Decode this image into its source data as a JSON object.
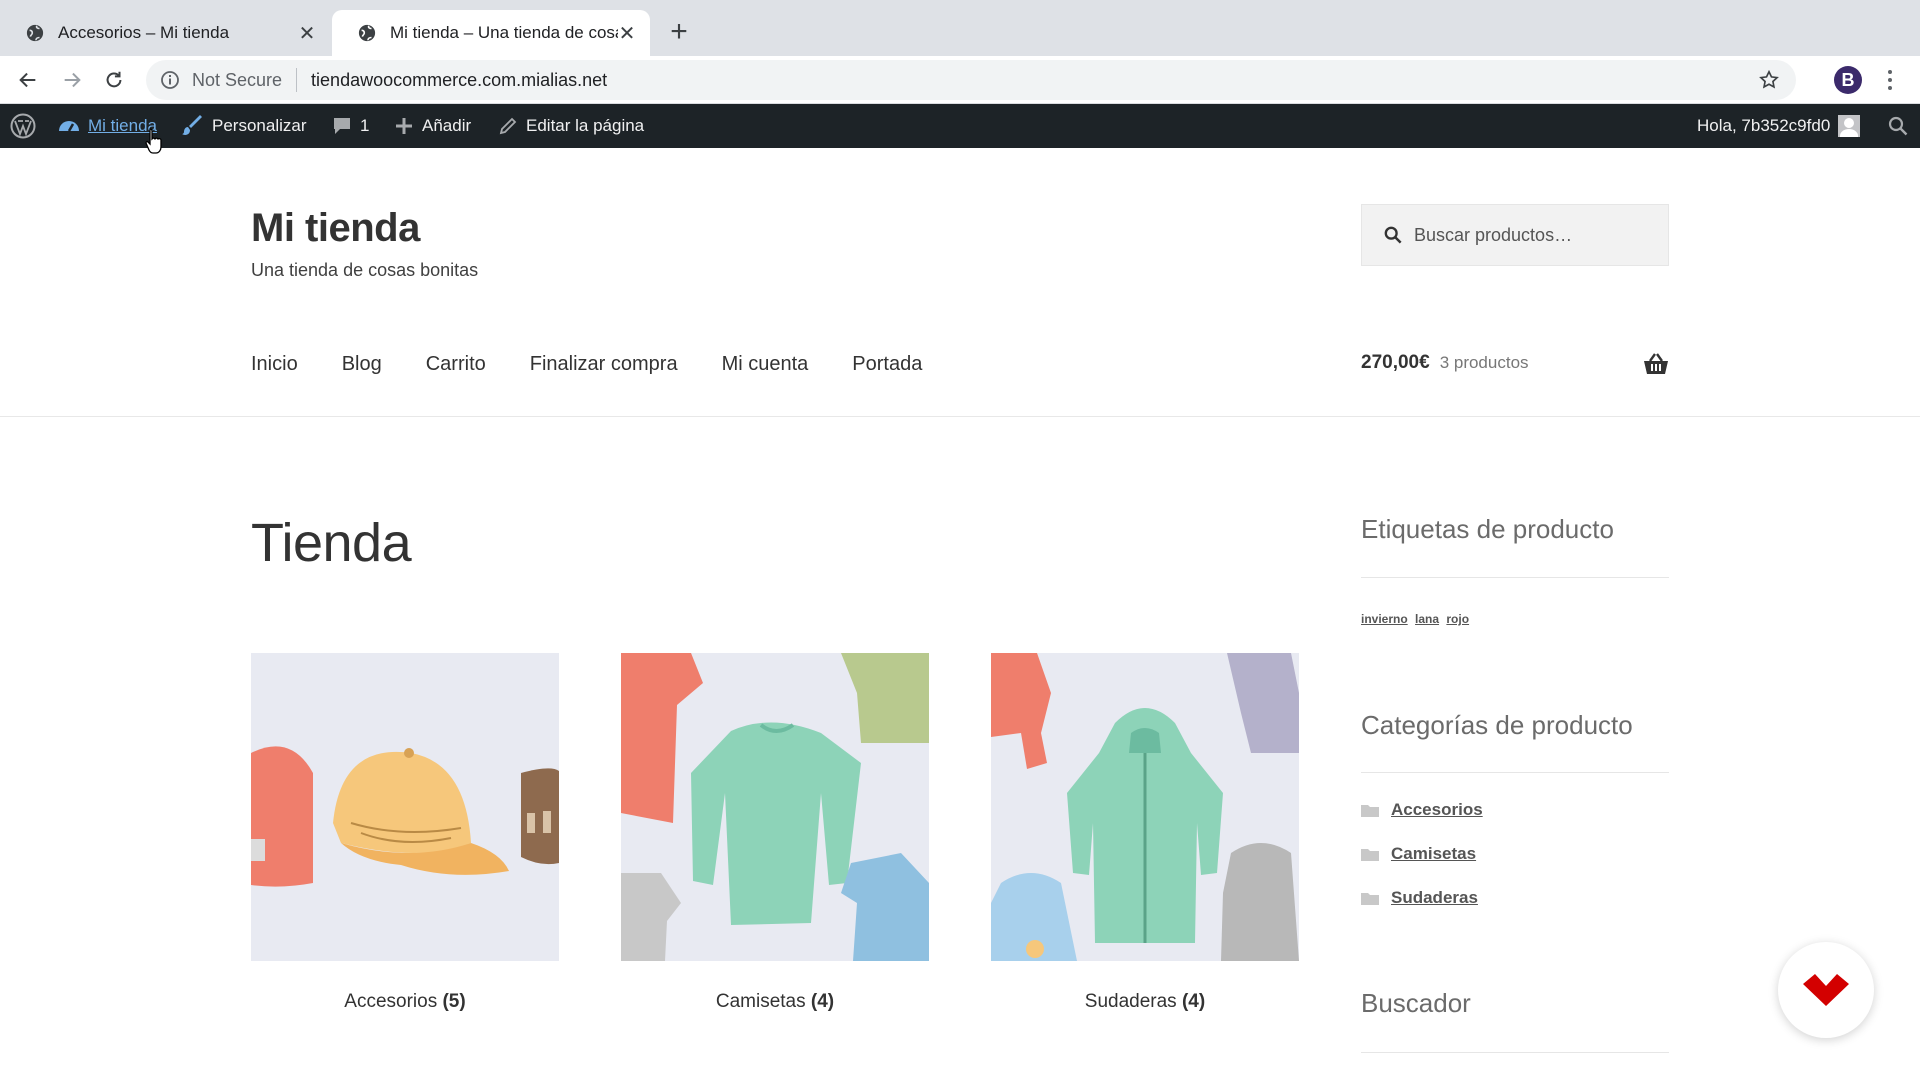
{
  "browser": {
    "tabs": [
      {
        "title": "Accesorios – Mi tienda",
        "active": false
      },
      {
        "title": "Mi tienda – Una tienda de cosas",
        "active": true
      }
    ],
    "omnibox": {
      "security_label": "Not Secure",
      "url": "tiendawoocommerce.com.mialias.net"
    },
    "profile_initial": "B"
  },
  "adminbar": {
    "site": "Mi tienda",
    "customize": "Personalizar",
    "comments_count": "1",
    "add_new": "Añadir",
    "edit_page": "Editar la página",
    "greeting": "Hola, 7b352c9fd0"
  },
  "site": {
    "title": "Mi tienda",
    "description": "Una tienda de cosas bonitas",
    "search_placeholder": "Buscar productos…"
  },
  "nav": [
    "Inicio",
    "Blog",
    "Carrito",
    "Finalizar compra",
    "Mi cuenta",
    "Portada"
  ],
  "cart": {
    "amount": "270,00€",
    "count": "3 productos"
  },
  "page_title": "Tienda",
  "categories": [
    {
      "name": "Accesorios",
      "count": "(5)"
    },
    {
      "name": "Camisetas",
      "count": "(4)"
    },
    {
      "name": "Sudaderas",
      "count": "(4)"
    }
  ],
  "sidebar": {
    "tags_title": "Etiquetas de producto",
    "tags": [
      "invierno",
      "lana",
      "rojo"
    ],
    "categories_title": "Categorías de producto",
    "category_links": [
      "Accesorios",
      "Camisetas",
      "Sudaderas"
    ],
    "search_title": "Buscador"
  },
  "colors": {
    "adminbar": "#1d2327",
    "adminbar_highlight": "#72aee6",
    "brand_accent": "#d30000"
  }
}
